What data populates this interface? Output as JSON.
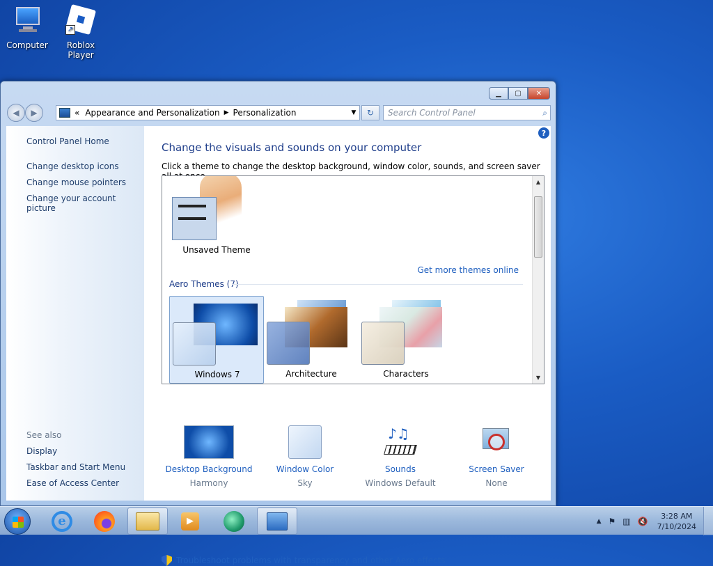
{
  "desktop": {
    "icons": [
      {
        "label": "Computer"
      },
      {
        "label": "Roblox Player"
      }
    ]
  },
  "window": {
    "buttons": {
      "minimize": "▁",
      "maximize": "▢",
      "close": "✕"
    },
    "address": {
      "prefix": "«",
      "crumbs": [
        "Appearance and Personalization",
        "Personalization"
      ],
      "separator": "▶",
      "dropdown": "▼"
    },
    "refresh_glyph": "↻",
    "search": {
      "placeholder": "Search Control Panel",
      "icon": "⌕"
    },
    "help_glyph": "?"
  },
  "sidebar": {
    "home": "Control Panel Home",
    "links": [
      "Change desktop icons",
      "Change mouse pointers",
      "Change your account picture"
    ],
    "see_also_header": "See also",
    "see_also": [
      "Display",
      "Taskbar and Start Menu",
      "Ease of Access Center"
    ]
  },
  "main": {
    "title": "Change the visuals and sounds on your computer",
    "description": "Click a theme to change the desktop background, window color, sounds, and screen saver all at once.",
    "unsaved_theme": "Unsaved Theme",
    "get_more": "Get more themes online",
    "aero_header": "Aero Themes (7)",
    "themes": [
      {
        "name": "Windows 7",
        "selected": true
      },
      {
        "name": "Architecture",
        "selected": false
      },
      {
        "name": "Characters",
        "selected": false
      }
    ],
    "bottom": [
      {
        "label": "Desktop Background",
        "value": "Harmony"
      },
      {
        "label": "Window Color",
        "value": "Sky"
      },
      {
        "label": "Sounds",
        "value": "Windows Default"
      },
      {
        "label": "Screen Saver",
        "value": "None"
      }
    ],
    "troubleshoot": "Troubleshoot problems with transparency and other Aero effects"
  },
  "taskbar": {
    "apps": [
      "internet-explorer",
      "firefox",
      "file-explorer",
      "media-player",
      "app-green-circle",
      "control-panel"
    ],
    "tray": {
      "chevron": "▲",
      "time": "3:28 AM",
      "date": "7/10/2024"
    }
  },
  "colors": {
    "accent": "#1f5fbf",
    "heading": "#1e3d8a",
    "desktop": "#1a5cc4"
  }
}
